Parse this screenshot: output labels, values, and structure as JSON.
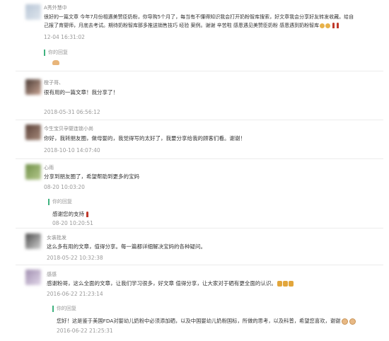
{
  "comments": [
    {
      "name": "A秀外慧中",
      "lines": [
        "很好的一篇文章 今年7月份相遇美赞臣奶粉，你导购5个月了，每当有不懂得知识我会打开奶粉智库搜索，好文章我会分享好友转发收藏。给自",
        "己报了育婴师，月底去考试。期待奶粉智库那多推送销售技巧 经验 案例。谢谢 辛苦啦 感恩遇见美赞臣奶粉 感恩遇到奶粉智库"
      ],
      "time": "12-04 16:31:02",
      "reply_label": "你的回复"
    },
    {
      "name": "橙子哥、",
      "lines": [
        "很有用的一篇文章！我分享了！"
      ],
      "time": "2018-05-31 06:56:12"
    },
    {
      "name": "今生宝贝孕婴连锁小尚",
      "lines": [
        "你好，我转朋友圈，做母婴的，我觉得写的太好了，我要分享给我的顾客们看。谢谢！"
      ],
      "time": "2018-10-10 14:07:40"
    },
    {
      "name": "心雨",
      "lines": [
        "分享到朋友圈了，希望帮助到更多的宝妈"
      ],
      "time": "08-20 10:03:20",
      "reply_label": "你的回复",
      "reply_text": "感谢您的支持",
      "reply_time": "08-20 10:20:51"
    },
    {
      "name": "女装批发",
      "lines": [
        "这么多有用的文章，值得分享。每一篇都详细解决宝妈的各种疑问。"
      ],
      "time": "2018-05-22 10:32:38"
    },
    {
      "name": "感感",
      "lines": [
        "感谢粉哥，这么全面的文章，让我们学习很多，好文章 值得分享，让大家对于硒有更全面的认识。"
      ],
      "time": "2016-06-22 21:23:14",
      "reply_label": "你的回复",
      "reply_text": "您好！这是鉴于美国FDA对婴幼儿奶粉中必须添加硒，以及中国婴幼儿奶粉国标，所做的思考，以及科普，希望您喜欢，谢谢",
      "reply_time": "2016-06-22 21:25:31"
    }
  ],
  "colors": {
    "accent": "#3fb27f",
    "muted": "#9a9a9a",
    "text": "#333333"
  }
}
